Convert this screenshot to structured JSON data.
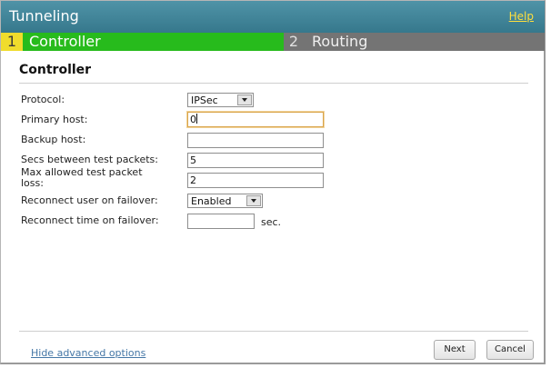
{
  "header": {
    "title": "Tunneling",
    "help_label": "Help"
  },
  "tabs": [
    {
      "number": "1",
      "label": "Controller",
      "active": true
    },
    {
      "number": "2",
      "label": "Routing",
      "active": false
    }
  ],
  "section": {
    "title": "Controller"
  },
  "form": {
    "protocol": {
      "label": "Protocol:",
      "value": "IPSec"
    },
    "primary_host": {
      "label": "Primary host:",
      "value": "0"
    },
    "backup_host": {
      "label": "Backup host:",
      "value": ""
    },
    "secs_between": {
      "label": "Secs between test packets:",
      "value": "5"
    },
    "max_loss": {
      "label_line1": "Max allowed test packet",
      "label_line2": "loss:",
      "value": "2"
    },
    "reconnect_user": {
      "label": "Reconnect user on failover:",
      "value": "Enabled"
    },
    "reconnect_time": {
      "label": "Reconnect time on failover:",
      "value": "",
      "unit": "sec."
    }
  },
  "footer": {
    "advanced_link": "Hide advanced options",
    "next_label": "Next",
    "cancel_label": "Cancel"
  },
  "colors": {
    "titlebar": "#3d8296",
    "active_tab": "#27bb1c",
    "active_tab_number": "#f0dc2c",
    "inactive_tab": "#747474",
    "help_link": "#ffdf3d",
    "link": "#4577a6"
  }
}
